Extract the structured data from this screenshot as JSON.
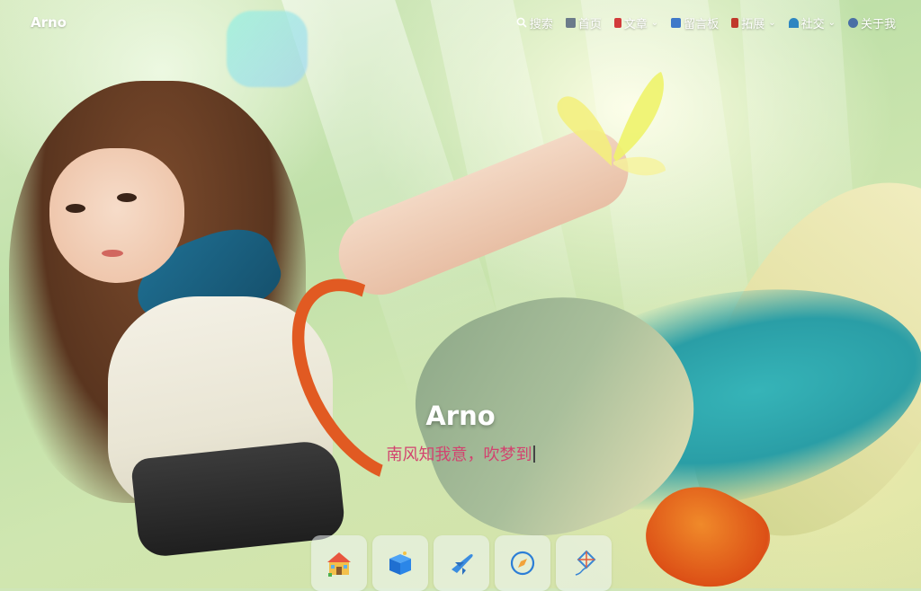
{
  "site": {
    "brand": "Arno"
  },
  "nav": {
    "items": [
      {
        "label": "搜索",
        "icon": "search-icon",
        "has_menu": false
      },
      {
        "label": "首页",
        "icon": "home-icon",
        "has_menu": false
      },
      {
        "label": "文章",
        "icon": "article-icon",
        "has_menu": true
      },
      {
        "label": "留言板",
        "icon": "message-board-icon",
        "has_menu": false
      },
      {
        "label": "拓展",
        "icon": "extension-icon",
        "has_menu": true
      },
      {
        "label": "社交",
        "icon": "social-icon",
        "has_menu": true
      },
      {
        "label": "关于我",
        "icon": "about-icon",
        "has_menu": false
      }
    ]
  },
  "hero": {
    "title": "Arno",
    "subtitle": "南风知我意，吹梦到"
  },
  "dock": {
    "items": [
      {
        "icon": "house-icon"
      },
      {
        "icon": "box-icon"
      },
      {
        "icon": "airplane-icon"
      },
      {
        "icon": "compass-icon"
      },
      {
        "icon": "kite-icon"
      }
    ]
  },
  "colors": {
    "subtitle": "#d2436f",
    "nav_text": "#ffffff"
  }
}
